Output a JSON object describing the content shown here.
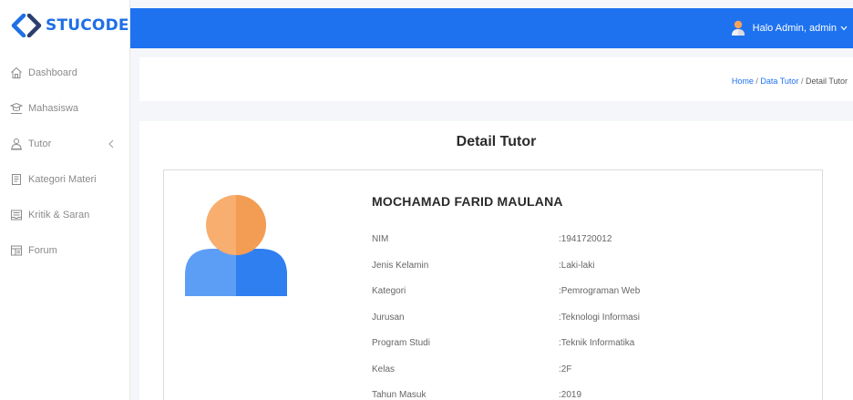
{
  "brand": {
    "name": "STUCODE",
    "color": "#1f6fe5"
  },
  "sidebar": {
    "items": [
      {
        "label": "Dashboard",
        "icon": "home-icon"
      },
      {
        "label": "Mahasiswa",
        "icon": "students-icon"
      },
      {
        "label": "Tutor",
        "icon": "tutor-icon",
        "has_submenu": true
      },
      {
        "label": "Kategori Materi",
        "icon": "book-icon"
      },
      {
        "label": "Kritik & Saran",
        "icon": "inbox-icon"
      },
      {
        "label": "Forum",
        "icon": "forum-icon"
      }
    ]
  },
  "topbar": {
    "greeting": "Halo Admin, admin",
    "color": "#1e72f0"
  },
  "breadcrumb": {
    "home": "Home",
    "separator": "/",
    "data_tutor": "Data Tutor",
    "current": "Detail Tutor"
  },
  "detail": {
    "title": "Detail Tutor",
    "name": "MOCHAMAD FARID MAULANA",
    "fields": [
      {
        "label": "NIM",
        "value": ":1941720012"
      },
      {
        "label": "Jenis Kelamin",
        "value": ":Laki-laki"
      },
      {
        "label": "Kategori",
        "value": ":Pemrograman Web"
      },
      {
        "label": "Jurusan",
        "value": ":Teknologi Informasi"
      },
      {
        "label": "Program Studi",
        "value": ":Teknik Informatika"
      },
      {
        "label": "Kelas",
        "value": ":2F"
      },
      {
        "label": "Tahun Masuk",
        "value": ":2019"
      }
    ]
  }
}
